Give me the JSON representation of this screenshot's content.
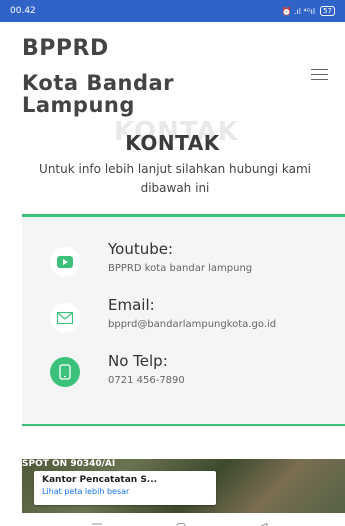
{
  "status_bar": {
    "time": "00.42",
    "icons": "⏰ .ıl ⁴ᴳıl",
    "battery": "57"
  },
  "header": {
    "title_line1": "BPPRD",
    "title_line2": "Kota Bandar Lampung"
  },
  "section": {
    "ghost_text": "KONTAK",
    "title": "KONTAK",
    "subtitle": "Untuk info lebih lanjut silahkan hubungi kami dibawah ini"
  },
  "contacts": [
    {
      "label": "Youtube:",
      "value": "BPPRD kota bandar lampung",
      "icon": "youtube-icon"
    },
    {
      "label": "Email:",
      "value": "bpprd@bandarlampungkota.go.id",
      "icon": "mail-icon"
    },
    {
      "label": "No Telp:",
      "value": "0721 456-7890",
      "icon": "phone-icon"
    }
  ],
  "map": {
    "overlay_text": "SPOT ON 90340/AI",
    "card_title": "Kantor Pencatatan S...",
    "card_link": "Lihat peta lebih besar"
  },
  "colors": {
    "status_bar": "#2f63c7",
    "accent": "#3cc17a"
  }
}
